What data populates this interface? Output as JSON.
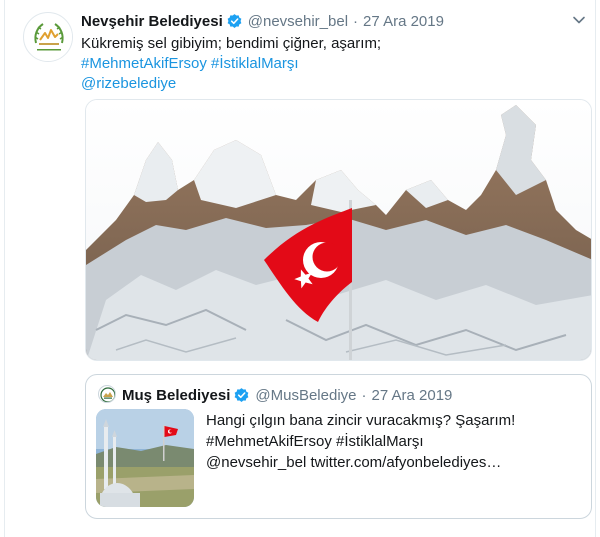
{
  "tweet": {
    "author_name": "Nevşehir Belediyesi",
    "handle": "@nevsehir_bel",
    "separator": "·",
    "date": "27 Ara 2019",
    "text_line1": "Kükremiş sel gibiyim; bendimi çiğner, aşarım;",
    "hashtag1": "#MehmetAkifErsoy",
    "hashtag2": "#İstiklalMarşı",
    "mention": "@rizebelediye",
    "avatar_icon": "municipality-logo-icon",
    "media_icon": "fairy-chimneys-with-turkish-flag-photo"
  },
  "quoted_tweet": {
    "author_name": "Muş Belediyesi",
    "handle": "@MusBelediye",
    "separator": "·",
    "date": "27 Ara 2019",
    "text_line1": "Hangi çılgın bana zincir vuracakmış? Şaşarım!",
    "hashtag1": "#MehmetAkifErsoy",
    "hashtag2": "#İstiklalMarşı",
    "mention": "@nevsehir_bel",
    "url": "twitter.com/afyonbelediyes…",
    "avatar_icon": "municipality-seal-icon",
    "thumb_icon": "minaret-and-flag-photo"
  },
  "colors": {
    "link": "#1b95e0",
    "verified": "#1da1f2",
    "muted": "#657786",
    "flag_red": "#e30a17"
  }
}
